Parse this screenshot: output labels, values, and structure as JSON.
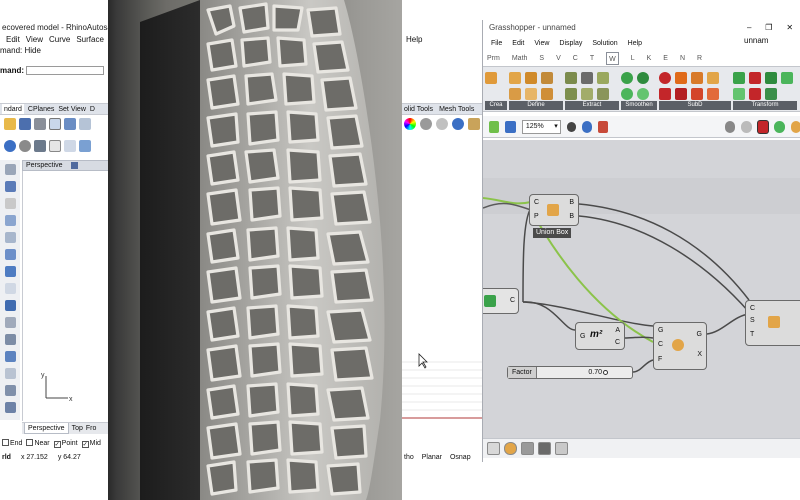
{
  "rhino": {
    "title": "ecovered model - RhinoAutosave",
    "menu": [
      "Edit",
      "View",
      "Curve",
      "Surface"
    ],
    "command_history": "mand: Hide",
    "command_prompt": "mand:",
    "toolbar_tabs": [
      "ndard",
      "CPlanes",
      "Set View",
      "D"
    ],
    "viewport_name": "Perspective",
    "axes": {
      "x": "x",
      "y": "y"
    },
    "viewport_tabs": [
      "Perspective",
      "Top",
      "Fro"
    ],
    "osnaps": [
      "End",
      "Near",
      "Point",
      "Mid"
    ],
    "osnap_checks": [
      "",
      "",
      "✓",
      "✓"
    ],
    "status": {
      "prefix": "rld",
      "x": "x 27.152",
      "y": "y 64.27"
    },
    "mid_menu": "Help",
    "mid_tabs": [
      "olid Tools",
      "Mesh Tools"
    ],
    "mid_status": [
      "tho",
      "Planar",
      "Osnap"
    ]
  },
  "grasshopper": {
    "title": "Grasshopper - unnamed",
    "title_right": "unnam",
    "menu": [
      "File",
      "Edit",
      "View",
      "Display",
      "Solution",
      "Help"
    ],
    "category_tabs": [
      "Prm",
      "Math",
      "S",
      "V",
      "C",
      "T",
      "W",
      "L",
      "K",
      "E",
      "N",
      "R"
    ],
    "active_category": "W",
    "ribbon_groups": [
      "Crea",
      "Define",
      "Extract",
      "Smoothen",
      "SubD",
      "Transform"
    ],
    "zoom": "125%",
    "nodes": {
      "union_box": {
        "label": "Union Box",
        "inputs": [
          "C",
          "P"
        ],
        "outputs": [
          "B",
          "B"
        ]
      },
      "param": {
        "output": "C"
      },
      "area": {
        "input": "G",
        "icon": "m²",
        "outputs": [
          "A",
          "C"
        ]
      },
      "smooth": {
        "inputs": [
          "G",
          "C",
          "F"
        ],
        "outputs": [
          "G",
          "X"
        ]
      },
      "right": {
        "inputs": [
          "C",
          "S",
          "T"
        ]
      }
    },
    "slider": {
      "name": "Factor",
      "value": "0.70"
    }
  },
  "colors": {
    "gh_canvas": "#d3d4d8",
    "wire_green": "#8bc34a",
    "wire_dark": "#4a4a4a",
    "render_bg": "#757570"
  },
  "window_controls": {
    "minimize": "–",
    "restore": "❐",
    "close": "✕"
  }
}
